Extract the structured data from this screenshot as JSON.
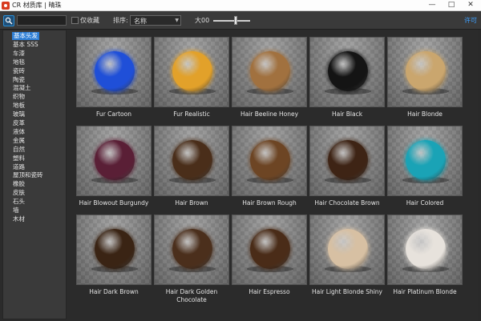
{
  "window": {
    "title": "CR 材质库 | 晴珠"
  },
  "toolbar": {
    "search_placeholder": "",
    "favorites_label": "仅收藏",
    "sort_label": "排序:",
    "sort_value": "名称",
    "size_label": "大00",
    "size_level": 0.6,
    "license_label": "许可"
  },
  "sidebar": {
    "items": [
      "基本头发",
      "基本 SSS",
      "车漆",
      "地毯",
      "瓷砖",
      "陶瓷",
      "混凝土",
      "织物",
      "地板",
      "玻璃",
      "皮革",
      "液体",
      "金属",
      "自然",
      "塑料",
      "道路",
      "屋顶和瓷砖",
      "橡胶",
      "皮肤",
      "石头",
      "墙",
      "木材"
    ],
    "selected_index": 0
  },
  "materials": [
    {
      "label": "Fur Cartoon",
      "color": "#1f4fd8"
    },
    {
      "label": "Fur Realistic",
      "color": "#e2a12a"
    },
    {
      "label": "Hair Beeline Honey",
      "color": "#a1713f"
    },
    {
      "label": "Hair Black",
      "color": "#141414"
    },
    {
      "label": "Hair Blonde",
      "color": "#caa66e"
    },
    {
      "label": "Hair Blowout Burgundy",
      "color": "#5a1f36"
    },
    {
      "label": "Hair Brown",
      "color": "#4a2e1a"
    },
    {
      "label": "Hair Brown Rough",
      "color": "#6d4524"
    },
    {
      "label": "Hair Chocolate Brown",
      "color": "#3e2415"
    },
    {
      "label": "Hair Colored",
      "color": "#1aa3b6"
    },
    {
      "label": "Hair Dark Brown",
      "color": "#3a2414"
    },
    {
      "label": "Hair Dark Golden Chocolate",
      "color": "#4b2f1c"
    },
    {
      "label": "Hair Espresso",
      "color": "#4a2c18"
    },
    {
      "label": "Hair Light Blonde Shiny",
      "color": "#d7c0a3"
    },
    {
      "label": "Hair Platinum Blonde",
      "color": "#e7e2dc"
    }
  ]
}
